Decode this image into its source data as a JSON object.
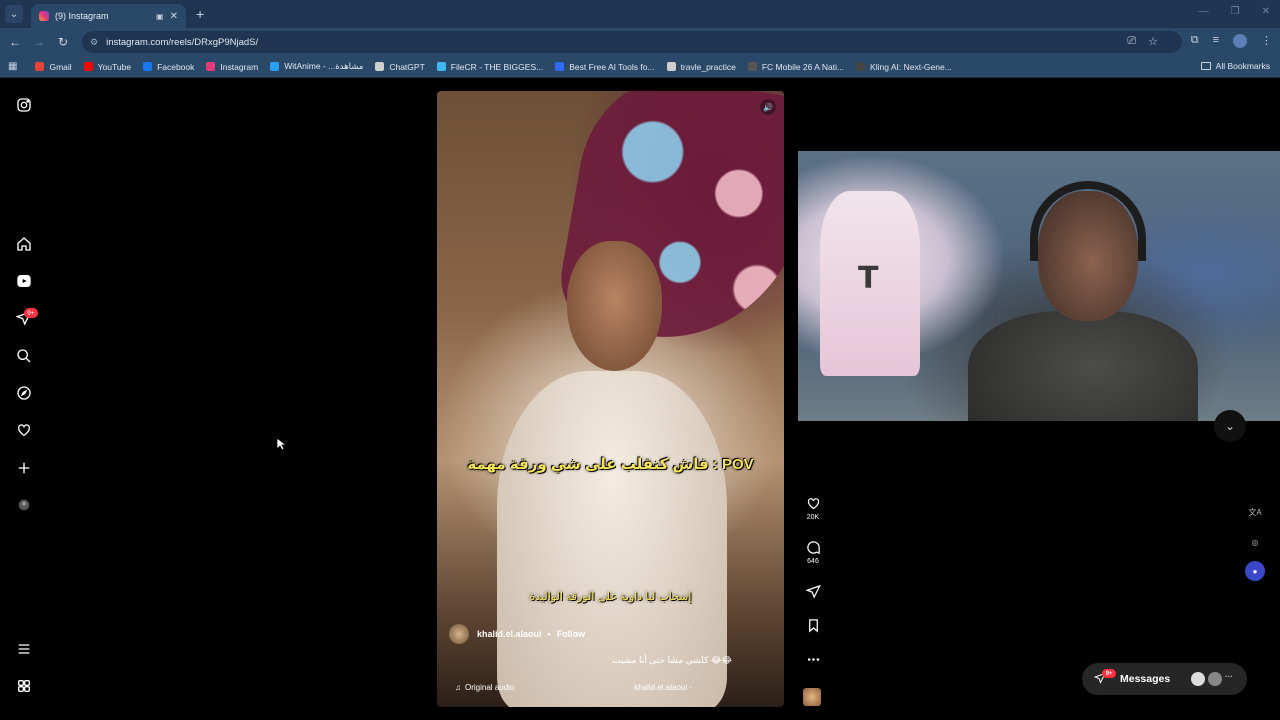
{
  "browser": {
    "tab_title": "(9) Instagram",
    "url": "instagram.com/reels/DRxgP9NjadS/",
    "new_tab": "+",
    "bookmarks": [
      {
        "label": "Gmail",
        "color": "#ea4335"
      },
      {
        "label": "YouTube",
        "color": "#ff0000"
      },
      {
        "label": "Facebook",
        "color": "#1877f2"
      },
      {
        "label": "Instagram",
        "color": "#e23a78"
      },
      {
        "label": "WitAnime - ...مشاهدة",
        "color": "#2a9df4"
      },
      {
        "label": "ChatGPT",
        "color": "#cfcfcf"
      },
      {
        "label": "FileCR - THE BIGGES...",
        "color": "#3fb6f0"
      },
      {
        "label": "Best Free AI Tools fo...",
        "color": "#2f6bff"
      },
      {
        "label": "travle_practice",
        "color": "#cfcfcf"
      },
      {
        "label": "FC Mobile 26 A Nati...",
        "color": "#555555"
      },
      {
        "label": "Kling AI: Next-Gene...",
        "color": "#444444"
      }
    ],
    "all_bookmarks": "All Bookmarks"
  },
  "sidebar": {
    "notifications_badge": "9+"
  },
  "reel": {
    "caption_overlay_top": "فاش كنقلب على شي ورقة مهمة : POV",
    "caption_overlay_bottom": "إسحاب ليا داوية على الورقة الواليدة",
    "username": "khalid.el.alaoui",
    "separator": "•",
    "follow": "Follow",
    "caption": "كلشي مشا حتى أنا مشيت 😂😂",
    "audio_label": "Original audio",
    "audio_user": "khalid.el.alaoui ·"
  },
  "actions": {
    "likes": "20K",
    "comments": "646"
  },
  "messages": {
    "label": "Messages",
    "badge": "9+"
  },
  "colors": {
    "brand_badge": "#ff3040",
    "chrome_tab": "#2a4868",
    "caption_yellow": "#f6e45a"
  }
}
